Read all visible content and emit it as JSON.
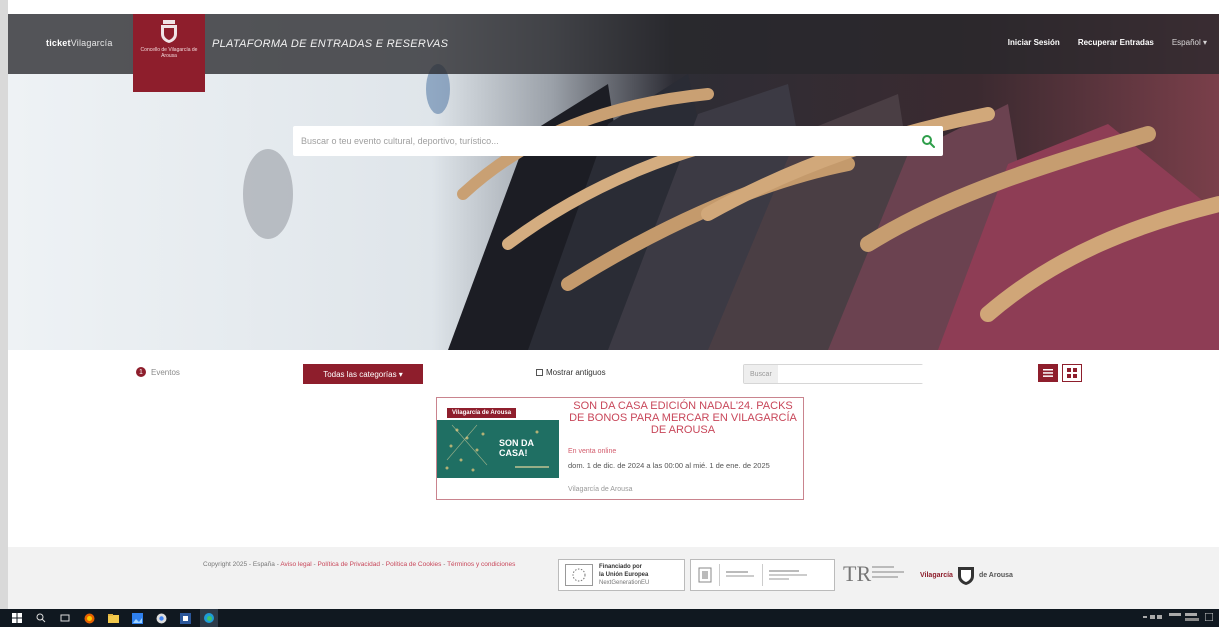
{
  "header": {
    "brand_strong": "ticket",
    "brand_light": "Vilagarcía",
    "crest_text": "Concello de Vilagarcía de Arousa",
    "platform_title": "PLATAFORMA DE ENTRADAS E RESERVAS",
    "nav": {
      "login": "Iniciar Sesión",
      "recover": "Recuperar Entradas",
      "language": "Español ▾"
    }
  },
  "search": {
    "placeholder": "Buscar o teu evento cultural, deportivo, turístico..."
  },
  "filters": {
    "events_count": "1",
    "events_label": "Eventos",
    "categories_button": "Todas las categorías ▾",
    "show_old_label": "Mostrar antiguos",
    "mini_search_label": "Buscar"
  },
  "event_card": {
    "tag": "Vilagarcía de Arousa",
    "title": "SON DA CASA EDICIÓN NADAL'24. PACKS DE BONOS PARA MERCAR EN VILAGARCÍA DE AROUSA",
    "image_text": "SON DA CASA!",
    "status": "En venta online",
    "date": "dom. 1 de dic. de 2024 a las 00:00 al mié. 1 de ene. de 2025",
    "place": "Vilagarcía de Arousa"
  },
  "footer": {
    "copyright_prefix": "Copyright 2025 - España -",
    "links": [
      "Aviso legal",
      "Política de Privacidad",
      "Política de Cookies",
      "Términos y condiciones"
    ],
    "eu_text": [
      "Financiado por",
      "la Unión Europea",
      "NextGenerationEU"
    ],
    "vila_text": "Vilagarcía",
    "vila_suffix": "de Arousa"
  },
  "colors": {
    "brand": "#8e1e2c",
    "accent": "#c8475a",
    "search_icon": "#2e9e4a"
  }
}
